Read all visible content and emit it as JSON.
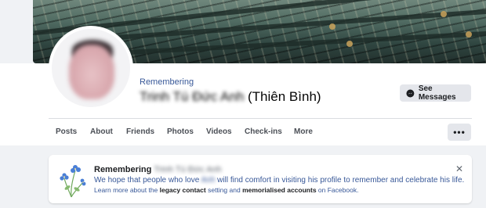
{
  "colors": {
    "link": "#385898",
    "button_bg": "#e4e6eb",
    "page_bg": "#f0f2f5"
  },
  "profile": {
    "remembering_label": "Remembering",
    "name_blurred": "Trinh Tú Đức Anh",
    "name_suffix": "(Thiên Bình)",
    "see_messages_label": "See Messages",
    "messenger_icon": "messenger-icon"
  },
  "tabs": [
    {
      "label": "Posts"
    },
    {
      "label": "About"
    },
    {
      "label": "Friends"
    },
    {
      "label": "Photos"
    },
    {
      "label": "Videos"
    },
    {
      "label": "Check-ins"
    },
    {
      "label": "More"
    }
  ],
  "more_button": {
    "label": "•••"
  },
  "memorial": {
    "title_prefix": "Remembering",
    "title_name_blurred": "Trinh Tú Đức Anh",
    "line1_before": "We hope that people who love",
    "line1_blurred": "Anh",
    "line1_after": "will find comfort in visiting his profile to remember and celebrate his life.",
    "line2_before": "Learn more about the",
    "line2_bold1": "legacy contact",
    "line2_mid": "setting and",
    "line2_bold2": "memorialised accounts",
    "line2_after": "on Facebook.",
    "close_symbol": "✕"
  }
}
